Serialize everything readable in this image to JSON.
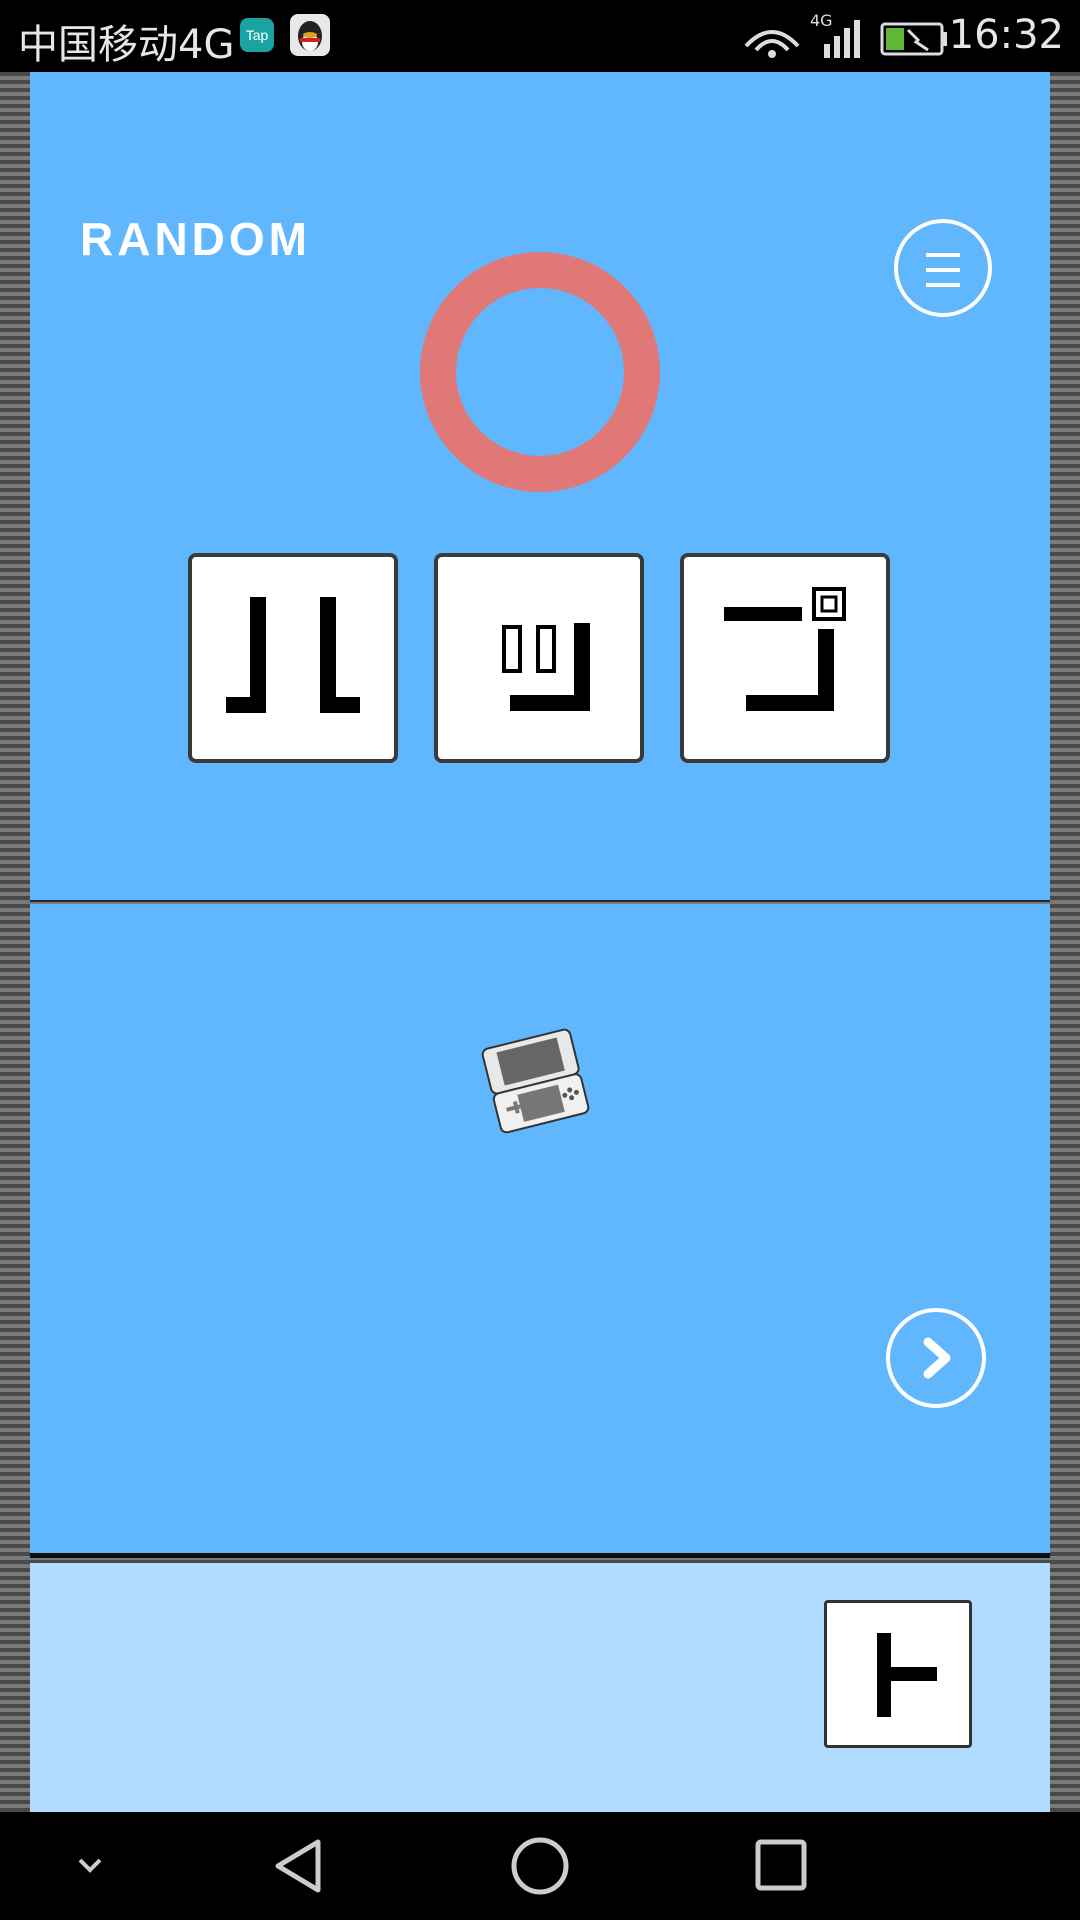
{
  "status_bar": {
    "carrier": "中国移动4G",
    "tap_app_icon": "Tap",
    "network": "4G",
    "time": "16:32"
  },
  "game": {
    "mode_label": "RANDOM",
    "menu_icon": "hamburger-menu-icon",
    "result_icon": "correct-circle-icon",
    "result_color": "#e07878",
    "tiles": [
      "glyph-tile-1",
      "glyph-tile-2",
      "glyph-tile-3"
    ],
    "hint_icon": "game-console-icon",
    "next_icon": "chevron-right-icon",
    "answer_tile_icon": "glyph-tile-answer"
  },
  "colors": {
    "panel": "#60b7fd",
    "tray": "#b1dcff"
  },
  "nav_bar": {
    "icons": [
      "chevron-down-icon",
      "back-triangle-icon",
      "home-circle-icon",
      "recents-square-icon"
    ]
  }
}
